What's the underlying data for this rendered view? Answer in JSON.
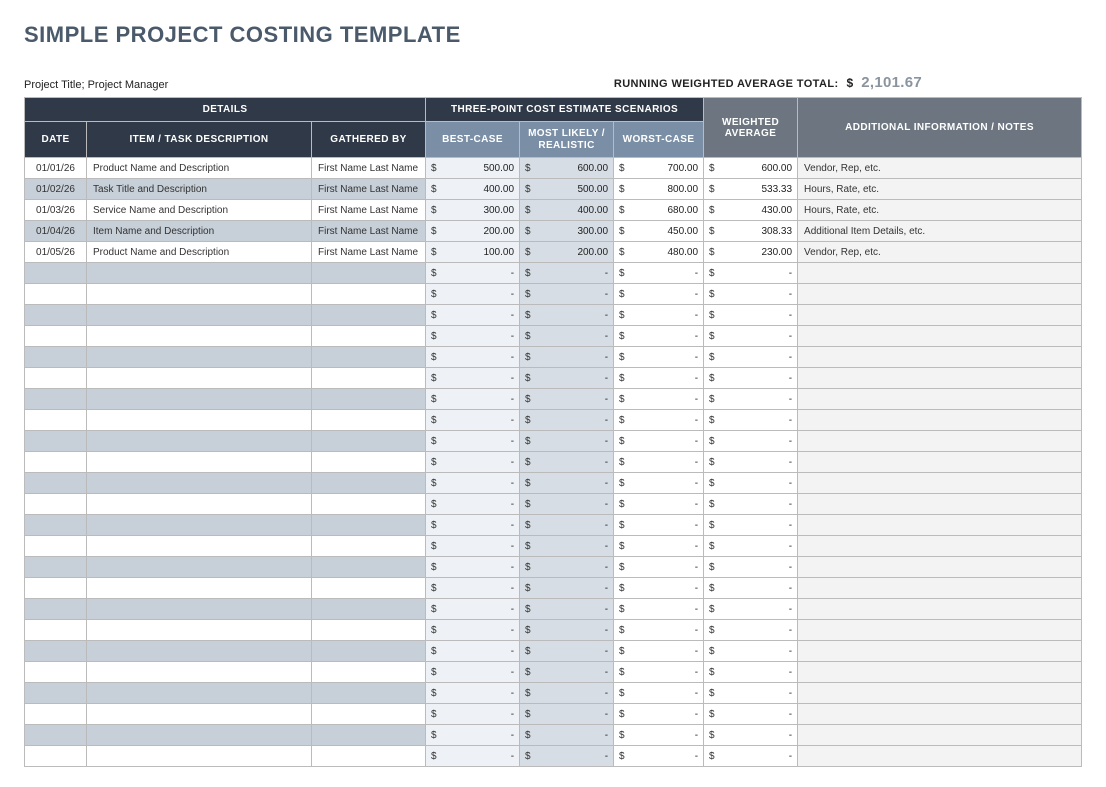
{
  "title": "SIMPLE PROJECT COSTING TEMPLATE",
  "project_line": "Project Title; Project Manager",
  "running_label": "RUNNING WEIGHTED AVERAGE TOTAL:",
  "running_currency": "$",
  "running_total": "2,101.67",
  "headers": {
    "details": "DETAILS",
    "three_point": "THREE-POINT COST ESTIMATE SCENARIOS",
    "weighted": "WEIGHTED AVERAGE",
    "notes": "ADDITIONAL INFORMATION / NOTES",
    "date": "DATE",
    "item": "ITEM / TASK DESCRIPTION",
    "gathered": "GATHERED BY",
    "best": "BEST-CASE",
    "most": "MOST LIKELY / REALISTIC",
    "worst": "WORST-CASE"
  },
  "rows": [
    {
      "date": "01/01/26",
      "item": "Product Name and Description",
      "gathered": "First Name Last Name",
      "best": "500.00",
      "most": "600.00",
      "worst": "700.00",
      "wavg": "600.00",
      "notes": "Vendor, Rep, etc."
    },
    {
      "date": "01/02/26",
      "item": "Task Title and Description",
      "gathered": "First Name Last Name",
      "best": "400.00",
      "most": "500.00",
      "worst": "800.00",
      "wavg": "533.33",
      "notes": "Hours, Rate, etc."
    },
    {
      "date": "01/03/26",
      "item": "Service Name and Description",
      "gathered": "First Name Last Name",
      "best": "300.00",
      "most": "400.00",
      "worst": "680.00",
      "wavg": "430.00",
      "notes": "Hours, Rate, etc."
    },
    {
      "date": "01/04/26",
      "item": "Item Name and Description",
      "gathered": "First Name Last Name",
      "best": "200.00",
      "most": "300.00",
      "worst": "450.00",
      "wavg": "308.33",
      "notes": "Additional Item Details, etc."
    },
    {
      "date": "01/05/26",
      "item": "Product Name and Description",
      "gathered": "First Name Last Name",
      "best": "100.00",
      "most": "200.00",
      "worst": "480.00",
      "wavg": "230.00",
      "notes": "Vendor, Rep, etc."
    }
  ],
  "empty_row_count": 24,
  "dash": "-"
}
